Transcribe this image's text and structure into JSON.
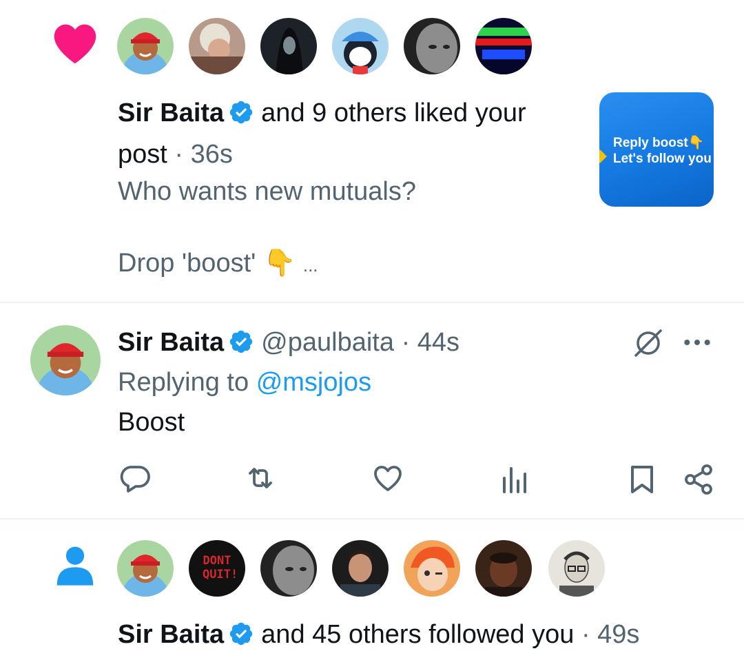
{
  "like_notification": {
    "icon": "heart-icon",
    "icon_color": "#f91880",
    "user_name": "Sir Baita",
    "verified": true,
    "action_text": "and 9 others liked your",
    "action_text_2": "post",
    "separator": "·",
    "time": "36s",
    "post_line1": "Who wants new mutuals?",
    "post_line2": "Drop 'boost'",
    "post_emoji": "👇",
    "ellipsis": "...",
    "thumbnail_text_1": "Reply boost",
    "thumbnail_emoji": "👇",
    "thumbnail_text_2": "Let's follow you"
  },
  "reply": {
    "user_name": "Sir Baita",
    "verified": true,
    "handle": "@paulbaita",
    "separator": "·",
    "time": "44s",
    "replying_to_label": "Replying to",
    "replying_to_handle": "@msjojos",
    "text": "Boost",
    "actions": [
      "reply-icon",
      "retweet-icon",
      "like-icon",
      "views-icon",
      "bookmark-icon",
      "share-icon"
    ]
  },
  "follow_notification": {
    "icon": "person-icon",
    "icon_color": "#1d9bf0",
    "user_name": "Sir Baita",
    "verified": true,
    "action_text": "and 45 others followed you",
    "separator": "·",
    "time": "49s",
    "avatar_badge_text": "DONT QUIT!"
  },
  "colors": {
    "accent": "#1d9bf0",
    "muted": "#536471",
    "text": "#0f1419",
    "divider": "#eff3f4"
  }
}
